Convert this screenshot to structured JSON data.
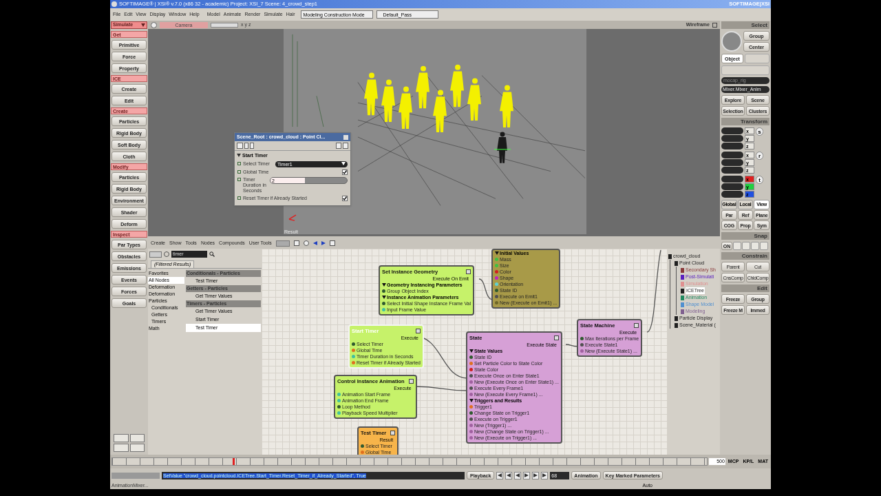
{
  "window": {
    "title": "SOFTIMAGE® | XSI® v.7.0 (x86 32 - academic) Project: XSI_7   Scene: 4_crowd_step1",
    "logo": "SOFTIMAGE|XSI"
  },
  "menu_bar": {
    "items": [
      "File",
      "Edit",
      "View",
      "Display",
      "Window",
      "Help",
      "Model",
      "Animate",
      "Render",
      "Simulate",
      "Hair"
    ],
    "mode": "Modeling Construction Mode",
    "pass": "Default_Pass"
  },
  "toolbar": {
    "title": "Simulate",
    "items": [
      {
        "kind": "header",
        "label": "Get"
      },
      {
        "kind": "button",
        "label": "Primitive"
      },
      {
        "kind": "button",
        "label": "Force"
      },
      {
        "kind": "button",
        "label": "Property"
      },
      {
        "kind": "header",
        "label": "ICE"
      },
      {
        "kind": "button",
        "label": "Create"
      },
      {
        "kind": "button",
        "label": "Edit"
      },
      {
        "kind": "header",
        "label": "Create"
      },
      {
        "kind": "button",
        "label": "Particles"
      },
      {
        "kind": "button",
        "label": "Rigid Body"
      },
      {
        "kind": "button",
        "label": "Soft Body"
      },
      {
        "kind": "button",
        "label": "Cloth"
      },
      {
        "kind": "header",
        "label": "Modify"
      },
      {
        "kind": "button",
        "label": "Particles"
      },
      {
        "kind": "button",
        "label": "Rigid Body"
      },
      {
        "kind": "button",
        "label": "Environment"
      },
      {
        "kind": "button",
        "label": "Shader"
      },
      {
        "kind": "button",
        "label": "Deform"
      },
      {
        "kind": "header",
        "label": "Inspect"
      },
      {
        "kind": "button",
        "label": "Par Types"
      },
      {
        "kind": "button",
        "label": "Obstacles"
      },
      {
        "kind": "button",
        "label": "Emissions"
      },
      {
        "kind": "button",
        "label": "Events"
      },
      {
        "kind": "button",
        "label": "Forces"
      },
      {
        "kind": "button",
        "label": "Goals"
      }
    ]
  },
  "viewport": {
    "camera": "Camera",
    "axes": "x y z",
    "display_mode": "Wireframe",
    "result_label": "Result"
  },
  "property_editor": {
    "title": "Scene_Root : crowd_cloud : Point Cl...",
    "section": "Start Timer",
    "rows": [
      {
        "kind": "dropdown",
        "label": "Select Timer",
        "value": "Timer1"
      },
      {
        "kind": "checkbox",
        "label": "Global Time",
        "checked": true
      },
      {
        "kind": "slider",
        "label": "Timer Duration in Seconds",
        "value": "2",
        "level": 0.45
      },
      {
        "kind": "checkbox",
        "label": "Reset Timer if Already Started",
        "checked": true
      }
    ]
  },
  "ice_editor": {
    "menu": [
      "Create",
      "Show",
      "Tools",
      "Nodes",
      "Compounds",
      "User Tools"
    ],
    "search": {
      "value": "timer"
    },
    "tab": "(Filtered Results)",
    "categories": [
      {
        "label": "Favorites",
        "selected": false
      },
      {
        "label": "All Nodes",
        "selected": true
      },
      {
        "label": "Deformation",
        "selected": false
      },
      {
        "label": "Deformation",
        "selected": false
      },
      {
        "label": "Particles",
        "selected": false,
        "children": [
          {
            "label": "Conditionals",
            "selected": false
          },
          {
            "label": "Getters",
            "selected": false
          },
          {
            "label": "Timers",
            "selected": false
          }
        ]
      },
      {
        "label": "Math",
        "selected": false
      }
    ],
    "results": [
      {
        "group": "Conditionals - Particles",
        "items": [
          {
            "label": "Test Timer",
            "selected": false
          }
        ]
      },
      {
        "group": "Getters - Particles",
        "items": [
          {
            "label": "Get Timer Values",
            "selected": false
          }
        ]
      },
      {
        "group": "Timers - Particles",
        "items": [
          {
            "label": "Get Timer Values",
            "selected": false
          },
          {
            "label": "Start Timer",
            "selected": false
          },
          {
            "label": "Test Timer",
            "selected": true
          }
        ]
      }
    ],
    "nodes": [
      {
        "title": "Set Instance Geometry",
        "color": "#c6f26a",
        "selected": false,
        "output": "Execute On Emit",
        "rows": [
          {
            "kind": "section",
            "label": "Geometry Instancing Parameters"
          },
          {
            "kind": "port",
            "label": "Group Object Index",
            "color": "#2f5a2f"
          },
          {
            "kind": "section",
            "label": "Instance Animation Parameters"
          },
          {
            "kind": "port",
            "label": "Select Initial Shape Instance Frame Val",
            "color": "#2f5a2f"
          },
          {
            "kind": "port",
            "label": "Input Frame Value",
            "color": "#40c0a0"
          }
        ]
      },
      {
        "color": "#a89a48",
        "selected": false,
        "rows": [
          {
            "kind": "section",
            "label": "Initial Values"
          },
          {
            "kind": "port",
            "label": "Mass",
            "color": "#40c040"
          },
          {
            "kind": "port",
            "label": "Size",
            "color": "#40c040"
          },
          {
            "kind": "port",
            "label": "Color",
            "color": "#d02020"
          },
          {
            "kind": "port",
            "label": "Shape",
            "color": "#c020c0"
          },
          {
            "kind": "port",
            "label": "Orientation",
            "color": "#60d0d0"
          },
          {
            "kind": "port",
            "label": "State ID",
            "color": "#2f5a2f"
          },
          {
            "kind": "port",
            "label": "Execute on Emit1",
            "color": "#505050"
          },
          {
            "kind": "port",
            "label": "New (Execute on Emit1) ...",
            "color": "#6e6628"
          }
        ]
      },
      {
        "title": "Start Timer",
        "color": "#c6f26a",
        "selected": true,
        "output": "Execute",
        "rows": [
          {
            "kind": "port",
            "label": "Select Timer",
            "color": "#2f5a2f"
          },
          {
            "kind": "port",
            "label": "Global Time",
            "color": "#e07020"
          },
          {
            "kind": "port",
            "label": "Timer Duration in Seconds",
            "color": "#40c0a0"
          },
          {
            "kind": "port",
            "label": "Reset Timer if Already Started",
            "color": "#e07020"
          }
        ]
      },
      {
        "title": "Control Instance Animation",
        "color": "#c6f26a",
        "selected": false,
        "output": "Execute",
        "rows": [
          {
            "kind": "port",
            "label": "Animation Start Frame",
            "color": "#40c0a0"
          },
          {
            "kind": "port",
            "label": "Animation End Frame",
            "color": "#40c0a0"
          },
          {
            "kind": "port",
            "label": "Loop Method",
            "color": "#2f5a2f"
          },
          {
            "kind": "port",
            "label": "Playback Speed Multiplier",
            "color": "#40c0a0"
          }
        ]
      },
      {
        "title": "Test Timer",
        "color": "#f7b44a",
        "selected": false,
        "output": "Result",
        "rows": [
          {
            "kind": "port",
            "label": "Select Timer",
            "color": "#2f5a2f"
          },
          {
            "kind": "port",
            "label": "Global Time",
            "color": "#e07020"
          }
        ]
      },
      {
        "title": "State",
        "color": "#d6a0d6",
        "selected": false,
        "output": "Execute State",
        "rows": [
          {
            "kind": "section",
            "label": "State Values"
          },
          {
            "kind": "port",
            "label": "State ID",
            "color": "#2f5a2f"
          },
          {
            "kind": "port",
            "label": "Set Particle Color to State Color",
            "color": "#e07020"
          },
          {
            "kind": "port",
            "label": "State Color",
            "color": "#d02020"
          },
          {
            "kind": "port",
            "label": "Execute Once on Enter State1",
            "color": "#505050"
          },
          {
            "kind": "port",
            "label": "New (Execute Once on Enter State1) ...",
            "color": "#a060a0"
          },
          {
            "kind": "port",
            "label": "Execute Every Frame1",
            "color": "#505050"
          },
          {
            "kind": "port",
            "label": "New (Execute Every Frame1) ...",
            "color": "#a060a0"
          },
          {
            "kind": "section",
            "label": "Triggers and Results"
          },
          {
            "kind": "port",
            "label": "Trigger1",
            "color": "#e07020"
          },
          {
            "kind": "port",
            "label": "Change State on Trigger1",
            "color": "#2f5a2f"
          },
          {
            "kind": "port",
            "label": "Execute on Trigger1",
            "color": "#505050"
          },
          {
            "kind": "port",
            "label": "New (Trigger1) ...",
            "color": "#a060a0"
          },
          {
            "kind": "port",
            "label": "New (Change State on Trigger1) ...",
            "color": "#a060a0"
          },
          {
            "kind": "port",
            "label": "New (Execute on Trigger1) ...",
            "color": "#a060a0"
          }
        ]
      },
      {
        "title": "State Machine",
        "color": "#d6a0d6",
        "selected": false,
        "output": "Execute",
        "rows": [
          {
            "kind": "port",
            "label": "Max Iterations per Frame",
            "color": "#2f5a2f"
          },
          {
            "kind": "port",
            "label": "Execute State1",
            "color": "#505050"
          },
          {
            "kind": "port",
            "label": "New (Execute State1) ...",
            "color": "#a060a0"
          }
        ]
      }
    ],
    "explorer": [
      {
        "label": "crowd_cloud",
        "color": "#202020",
        "selected": false,
        "children": [
          {
            "label": "Point Cloud",
            "color": "#202020",
            "selected": false,
            "children": [
              {
                "label": "Secondary Sh",
                "color": "#8a3a3a",
                "selected": false
              },
              {
                "label": "Post-Simulati",
                "color": "#5a20c0",
                "selected": false
              },
              {
                "label": "Simulation",
                "color": "#e09090",
                "selected": false
              },
              {
                "label": "ICETree",
                "color": "#202020",
                "selected": true
              },
              {
                "label": "Animation",
                "color": "#208a60",
                "selected": false
              },
              {
                "label": "Shape Model",
                "color": "#5090d0",
                "selected": false
              },
              {
                "label": "Modeling",
                "color": "#806090",
                "selected": false
              }
            ]
          },
          {
            "label": "Particle Display",
            "color": "#202020",
            "selected": false
          },
          {
            "label": "Scene_Material (",
            "color": "#202020",
            "selected": false
          }
        ]
      }
    ]
  },
  "right_panel": {
    "select": {
      "title": "Select",
      "group": "Group",
      "center": "Center",
      "filter": "Object",
      "name_field": "mocap_rig",
      "mixer_field": "Mixer.Mixer_Anim",
      "buttons": [
        "Explore",
        "Scene",
        "Selection",
        "Clusters"
      ]
    },
    "transform": {
      "title": "Transform",
      "groups": [
        {
          "label": "s",
          "axes": [
            {
              "label": "x"
            },
            {
              "label": "y"
            },
            {
              "label": "z"
            }
          ]
        },
        {
          "label": "r",
          "axes": [
            {
              "label": "x"
            },
            {
              "label": "y"
            },
            {
              "label": "z"
            }
          ]
        },
        {
          "label": "t",
          "axes": [
            {
              "label": "x",
              "color": "#e02020"
            },
            {
              "label": "y",
              "color": "#20d040"
            },
            {
              "label": "z",
              "color": "#2050e0"
            }
          ]
        }
      ]
    },
    "modes": [
      {
        "label": "Global",
        "selected": false
      },
      {
        "label": "Local",
        "selected": false
      },
      {
        "label": "View",
        "selected": true
      }
    ],
    "ref_buttons": [
      "Par",
      "Ref",
      "Plane",
      "COG",
      "Prop",
      "Sym"
    ],
    "snap": {
      "title": "Snap",
      "on": "ON"
    },
    "constrain": {
      "title": "Constrain",
      "buttons": [
        "Parent",
        "Cut",
        "CnsComp",
        "ChldComp"
      ]
    },
    "edit": {
      "title": "Edit",
      "buttons": [
        "Freeze",
        "Group",
        "Freeze M",
        "Immed"
      ]
    }
  },
  "timeline": {
    "end_frame": "500"
  },
  "bottom_bar": {
    "command": "SetValue \"crowd_cloud.pointcloud.ICETree.Start_Timer.Reset_Timer_if_Already_Started\", True",
    "playback": "Playback",
    "frame": "68",
    "animation": "Animation",
    "auto": "Auto",
    "key_params": "Key Marked Parameters",
    "tabs": [
      "MCP",
      "KP/L",
      "MAT"
    ],
    "mixer": "AnimationMixer..."
  }
}
